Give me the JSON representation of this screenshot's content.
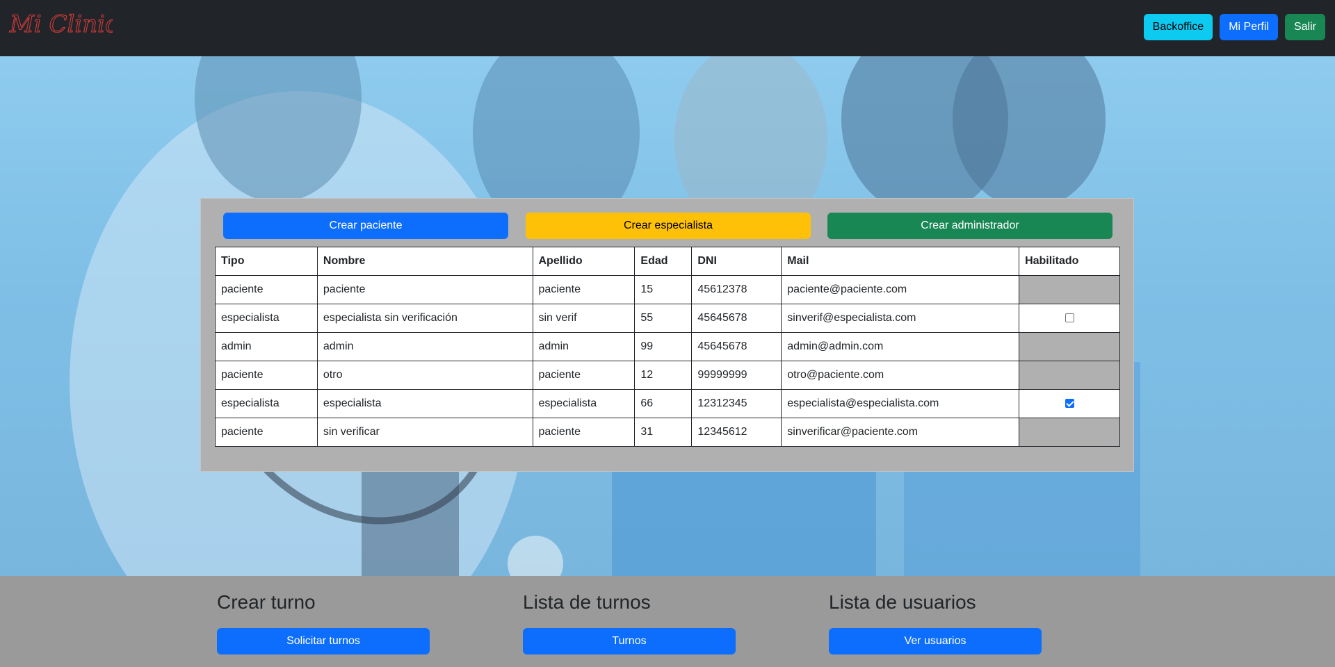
{
  "navbar": {
    "brand": "Mi Clinica",
    "buttons": [
      "Backoffice",
      "Mi Perfil",
      "Salir"
    ]
  },
  "panel": {
    "create_buttons": [
      "Crear paciente",
      "Crear especialista",
      "Crear administrador"
    ],
    "table": {
      "headers": [
        "Tipo",
        "Nombre",
        "Apellido",
        "Edad",
        "DNI",
        "Mail",
        "Habilitado"
      ],
      "rows": [
        {
          "tipo": "paciente",
          "nombre": "paciente",
          "apellido": "paciente",
          "edad": "15",
          "dni": "45612378",
          "mail": "paciente@paciente.com",
          "habilitado": null
        },
        {
          "tipo": "especialista",
          "nombre": "especialista sin verificación",
          "apellido": "sin verif",
          "edad": "55",
          "dni": "45645678",
          "mail": "sinverif@especialista.com",
          "habilitado": false
        },
        {
          "tipo": "admin",
          "nombre": "admin",
          "apellido": "admin",
          "edad": "99",
          "dni": "45645678",
          "mail": "admin@admin.com",
          "habilitado": null
        },
        {
          "tipo": "paciente",
          "nombre": "otro",
          "apellido": "paciente",
          "edad": "12",
          "dni": "99999999",
          "mail": "otro@paciente.com",
          "habilitado": null
        },
        {
          "tipo": "especialista",
          "nombre": "especialista",
          "apellido": "especialista",
          "edad": "66",
          "dni": "12312345",
          "mail": "especialista@especialista.com",
          "habilitado": true
        },
        {
          "tipo": "paciente",
          "nombre": "sin verificar",
          "apellido": "paciente",
          "edad": "31",
          "dni": "12345612",
          "mail": "sinverificar@paciente.com",
          "habilitado": null
        }
      ]
    }
  },
  "footer": {
    "sections": [
      {
        "title": "Crear turno",
        "button": "Solicitar turnos"
      },
      {
        "title": "Lista de turnos",
        "button": "Turnos"
      },
      {
        "title": "Lista de usuarios",
        "button": "Ver usuarios"
      }
    ]
  },
  "colors": {
    "navbar": "#212529",
    "info": "#0dcaf0",
    "primary": "#0d6efd",
    "success": "#198754",
    "warning": "#ffc107",
    "panel": "#b0b0b0"
  }
}
